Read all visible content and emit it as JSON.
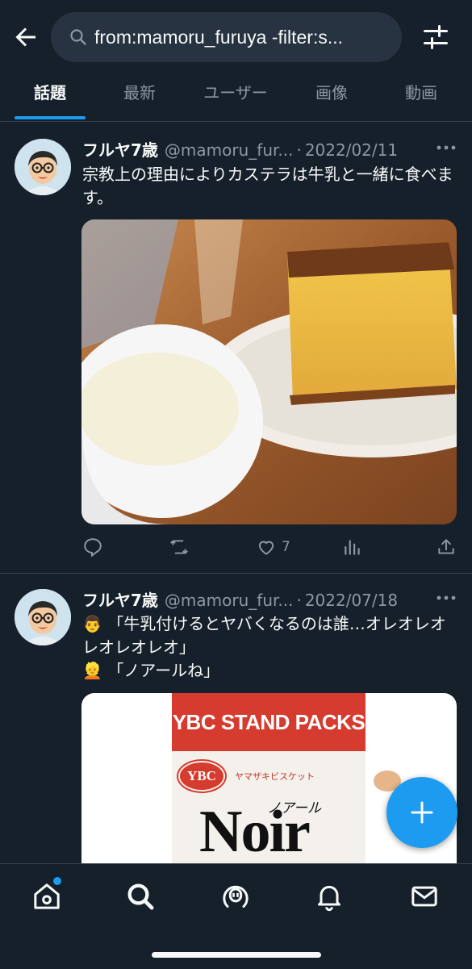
{
  "search": {
    "query": "from:mamoru_furuya -filter:s..."
  },
  "tabs": [
    {
      "label": "話題"
    },
    {
      "label": "最新"
    },
    {
      "label": "ユーザー"
    },
    {
      "label": "画像"
    },
    {
      "label": "動画"
    }
  ],
  "tweets": [
    {
      "name": "フルヤ7歳",
      "handle": "@mamoru_fur...",
      "separator": "·",
      "date": "2022/02/11",
      "text": "宗教上の理由によりカステラは牛乳と一緒に食べます。",
      "media_icon": "castella-and-milk-photo",
      "likes": "7"
    },
    {
      "name": "フルヤ7歳",
      "handle": "@mamoru_fur...",
      "separator": "·",
      "date": "2022/07/18",
      "line1_emoji": "👨",
      "line1": "「牛乳付けるとヤバくなるのは誰…オレオレオレオレオレオ」",
      "line2_emoji": "👱",
      "line2": "「ノアールね」",
      "media_icon": "noir-biscuit-package-photo",
      "package": {
        "banner": "YBC STAND PACKS",
        "maker_logo": "YBC",
        "maker_jp": "ヤマザキビスケット",
        "product_kana": "ノアール",
        "product": "Noir"
      }
    }
  ],
  "colors": {
    "background": "#15202b",
    "accent": "#1d9bf0",
    "muted": "#8b98a5"
  }
}
